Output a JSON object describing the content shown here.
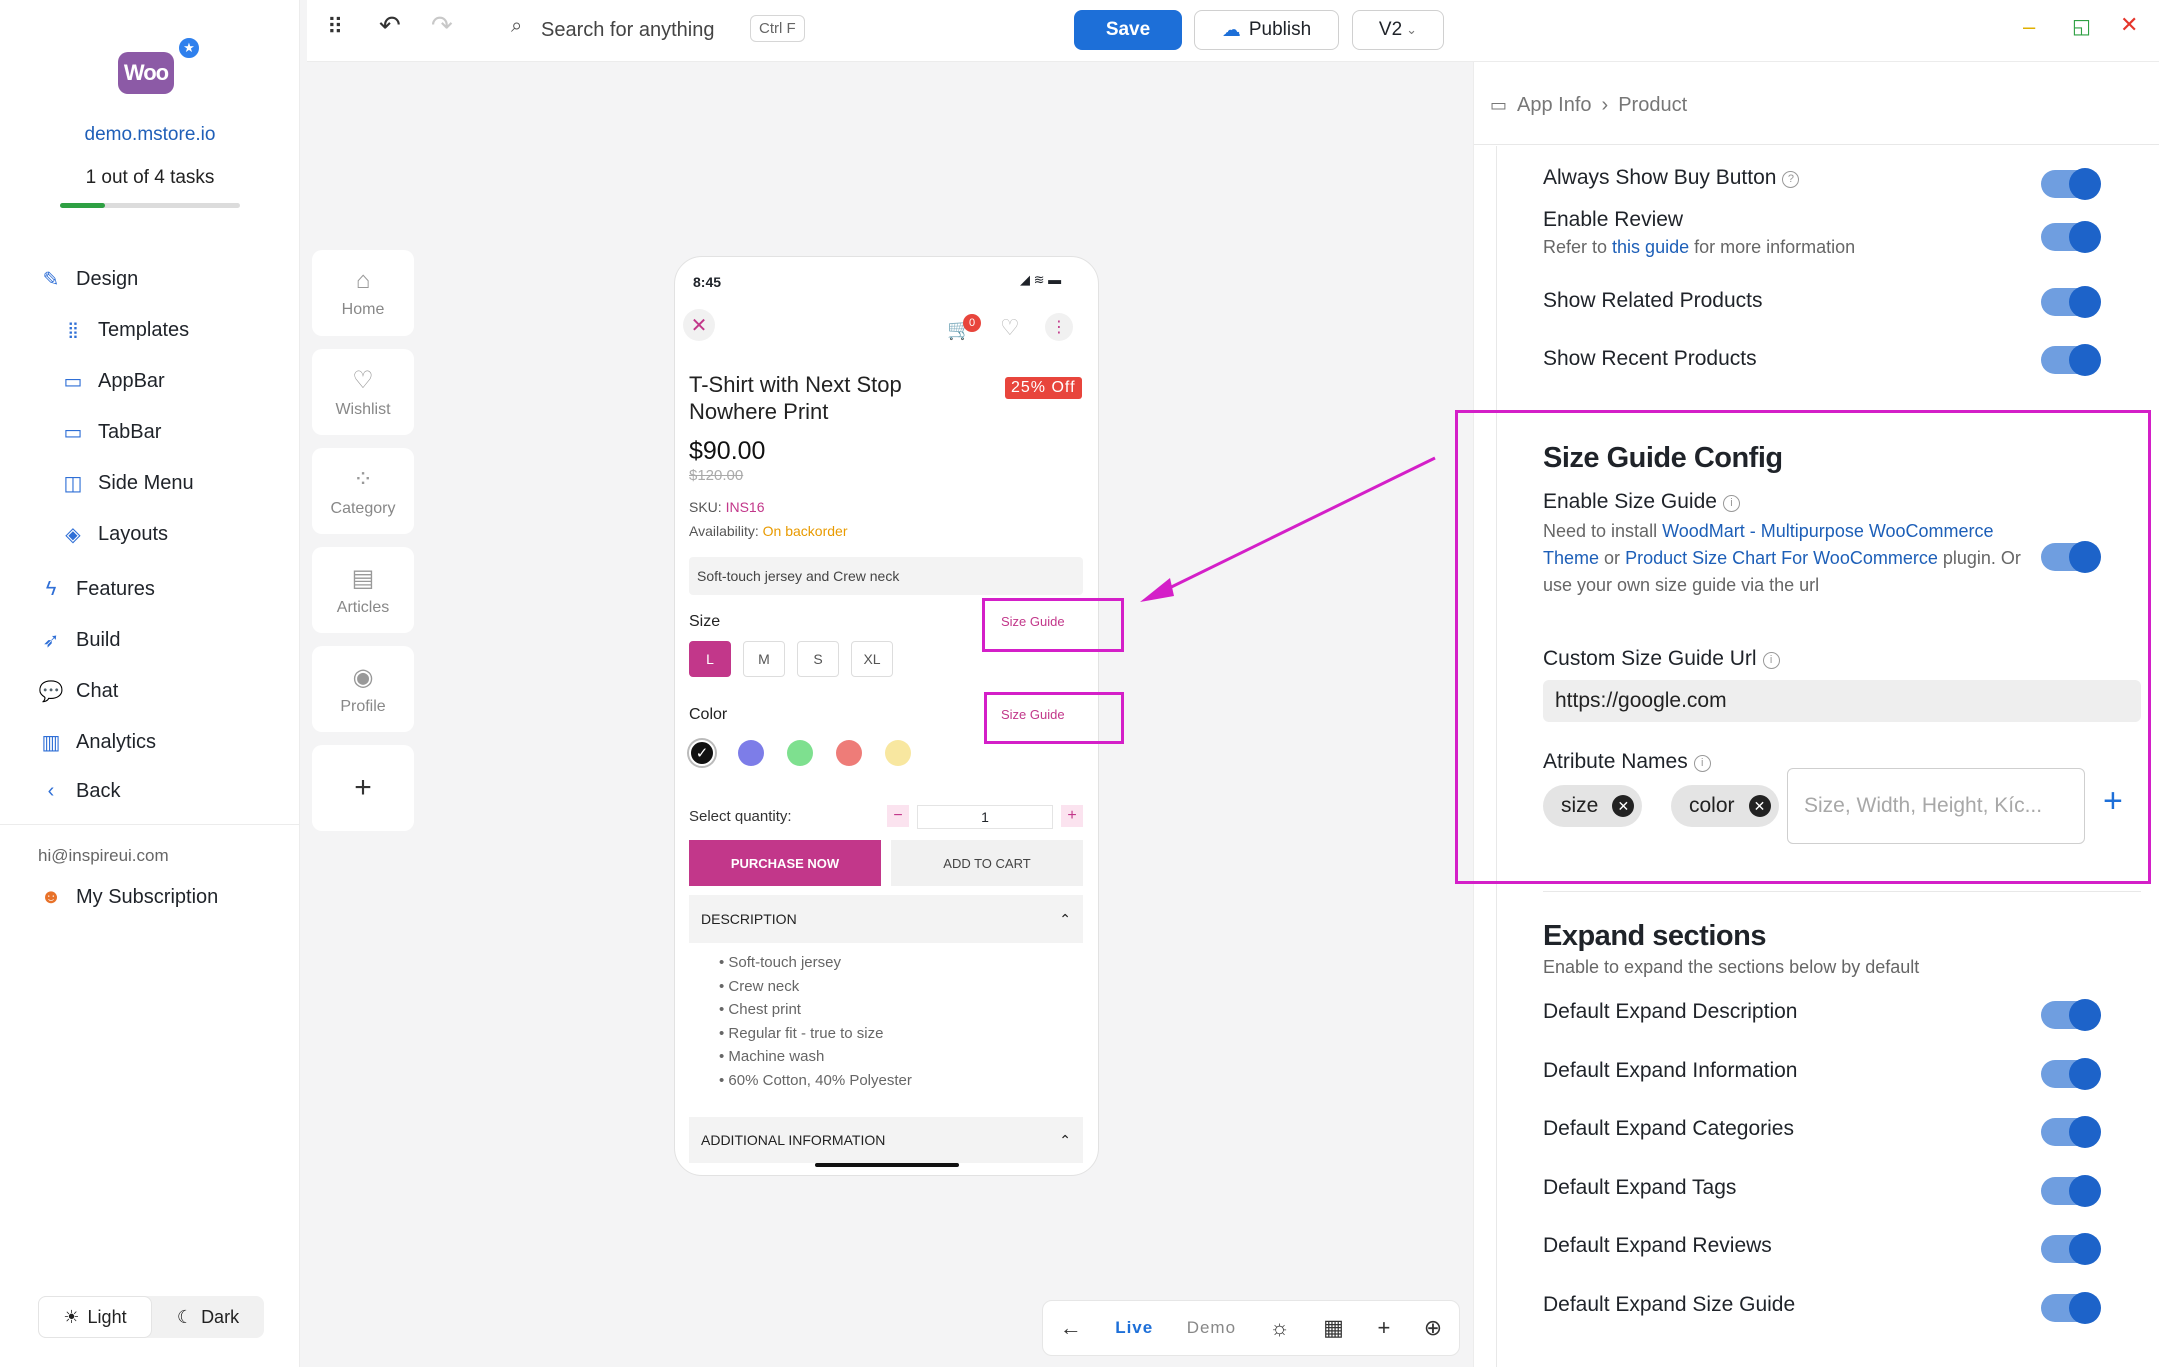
{
  "sidebar": {
    "site_url": "demo.mstore.io",
    "tasks": "1 out of 4 tasks",
    "tasks_progress": 0.25,
    "logo_text": "Woo",
    "nav": [
      {
        "label": "Design",
        "icon": "brush-icon",
        "level": 0
      },
      {
        "label": "Templates",
        "icon": "grid-icon",
        "level": 1
      },
      {
        "label": "AppBar",
        "icon": "appbar-icon",
        "level": 1
      },
      {
        "label": "TabBar",
        "icon": "tabbar-icon",
        "level": 1
      },
      {
        "label": "Side Menu",
        "icon": "side-menu-icon",
        "level": 1
      },
      {
        "label": "Layouts",
        "icon": "layers-icon",
        "level": 1
      },
      {
        "label": "Features",
        "icon": "bolt-icon",
        "level": 0
      },
      {
        "label": "Build",
        "icon": "rocket-icon",
        "level": 0
      },
      {
        "label": "Chat",
        "icon": "chat-icon",
        "level": 0
      },
      {
        "label": "Analytics",
        "icon": "analytics-icon",
        "level": 0
      },
      {
        "label": "Back",
        "icon": "chevron-left-icon",
        "level": 0
      }
    ],
    "email": "hi@inspireui.com",
    "subscription": "My Subscription",
    "theme_light": "Light",
    "theme_dark": "Dark"
  },
  "topbar": {
    "search_placeholder": "Search for anything",
    "shortcut": "Ctrl F",
    "save": "Save",
    "publish": "Publish",
    "version": "V2"
  },
  "rail": [
    {
      "label": "Home",
      "icon": "home-icon"
    },
    {
      "label": "Wishlist",
      "icon": "heart-icon"
    },
    {
      "label": "Category",
      "icon": "category-icon"
    },
    {
      "label": "Articles",
      "icon": "document-icon"
    },
    {
      "label": "Profile",
      "icon": "user-icon"
    }
  ],
  "phone": {
    "time": "8:45",
    "cart_count": "0",
    "title": "T-Shirt with Next Stop Nowhere Print",
    "discount": "25% Off",
    "price": "$90.00",
    "old_price": "$120.00",
    "sku_label": "SKU:",
    "sku": "INS16",
    "availability_label": "Availability:",
    "availability": "On backorder",
    "short_desc": "Soft-touch jersey and Crew neck",
    "size_label": "Size",
    "size_guide": "Size Guide",
    "sizes": [
      "L",
      "M",
      "S",
      "XL"
    ],
    "color_label": "Color",
    "colors": [
      "#111111",
      "#7d7de8",
      "#7ee08f",
      "#ee7c78",
      "#f8e7a0"
    ],
    "qty_label": "Select quantity:",
    "qty": "1",
    "purchase": "PURCHASE NOW",
    "add_to_cart": "ADD TO CART",
    "description_title": "DESCRIPTION",
    "description_items": [
      "Soft-touch jersey",
      "Crew neck",
      "Chest print",
      "Regular fit - true to size",
      "Machine wash",
      "60% Cotton, 40% Polyester"
    ],
    "additional_title": "ADDITIONAL INFORMATION"
  },
  "bottombar": {
    "live": "Live",
    "demo": "Demo"
  },
  "panel": {
    "breadcrumb": [
      "App Info",
      "Product"
    ],
    "top_rows": [
      {
        "label": "Always Show Buy Button",
        "info": true
      },
      {
        "label": "Enable Review"
      },
      {
        "label": "Show Related Products"
      },
      {
        "label": "Show Recent Products"
      }
    ],
    "review_sub_pre": "Refer to",
    "review_sub_link": "this guide",
    "review_sub_post": "for more information",
    "size_guide_title": "Size Guide Config",
    "enable_size_guide": "Enable Size Guide",
    "size_guide_sub_1": "Need to install",
    "size_guide_link_1": "WoodMart - Multipurpose WooCommerce Theme",
    "size_guide_sub_2": "or",
    "size_guide_link_2": "Product Size Chart For WooCommerce",
    "size_guide_sub_3": "plugin. Or use your own size guide via the url",
    "custom_url_label": "Custom Size Guide Url",
    "custom_url_value": "https://google.com",
    "attr_label": "Atribute Names",
    "attr_tags": [
      "size",
      "color"
    ],
    "attr_placeholder": "Size, Width, Height, Kíc...",
    "expand_title": "Expand sections",
    "expand_sub": "Enable to expand the sections below by default",
    "expand_rows": [
      "Default Expand Description",
      "Default Expand Information",
      "Default Expand Categories",
      "Default Expand Tags",
      "Default Expand Reviews",
      "Default Expand Size Guide"
    ]
  },
  "colors": {
    "accent": "#1d6fd8",
    "highlight": "#d41fc8",
    "product_pink": "#c2378a",
    "discount_red": "#e8453c",
    "backorder": "#e89a00"
  }
}
